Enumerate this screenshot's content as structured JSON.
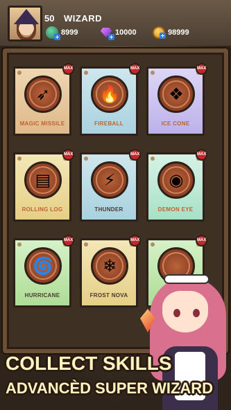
{
  "player": {
    "level": "50",
    "name": "WIZARD"
  },
  "resources": [
    {
      "icon": "green-gem-icon",
      "value": "8999"
    },
    {
      "icon": "purple-diamond-icon",
      "value": "10000"
    },
    {
      "icon": "gold-coin-icon",
      "value": "98999"
    }
  ],
  "skills": [
    {
      "name": "MAGIC MISSILE",
      "badge": "MAX",
      "theme": "orange",
      "color": "#c0642e",
      "glyph": "➶",
      "icon": "magic-missile-icon"
    },
    {
      "name": "FIREBALL",
      "badge": "MAX",
      "theme": "blue",
      "color": "#c0642e",
      "glyph": "🔥",
      "icon": "fireball-icon"
    },
    {
      "name": "ICE CONE",
      "badge": "MAX",
      "theme": "purple",
      "color": "#c0642e",
      "glyph": "❖",
      "icon": "ice-cone-icon"
    },
    {
      "name": "ROLLING LOG",
      "badge": "MAX",
      "theme": "yellow",
      "color": "#c0642e",
      "glyph": "▤",
      "icon": "rolling-log-icon"
    },
    {
      "name": "THUNDER",
      "badge": "MAX",
      "theme": "blue",
      "color": "#4a3a2e",
      "glyph": "⚡",
      "icon": "thunder-icon"
    },
    {
      "name": "DEMON EYE",
      "badge": "MAX",
      "theme": "teal",
      "color": "#c0642e",
      "glyph": "◉",
      "icon": "demon-eye-icon"
    },
    {
      "name": "HURRICANE",
      "badge": "MAX",
      "theme": "green",
      "color": "#4a3a2e",
      "glyph": "🌀",
      "icon": "hurricane-icon"
    },
    {
      "name": "FROST NOVA",
      "badge": "MAX",
      "theme": "yellow",
      "color": "#4a3a2e",
      "glyph": "❄",
      "icon": "frost-nova-icon"
    },
    {
      "name": "",
      "badge": "MAX",
      "theme": "green",
      "color": "#4a3a2e",
      "glyph": "",
      "icon": "hidden-skill-icon"
    }
  ],
  "banner": {
    "line1": "COLLECT SKILLS",
    "line2": "ADVANCÈD SUPER WIZARD"
  }
}
